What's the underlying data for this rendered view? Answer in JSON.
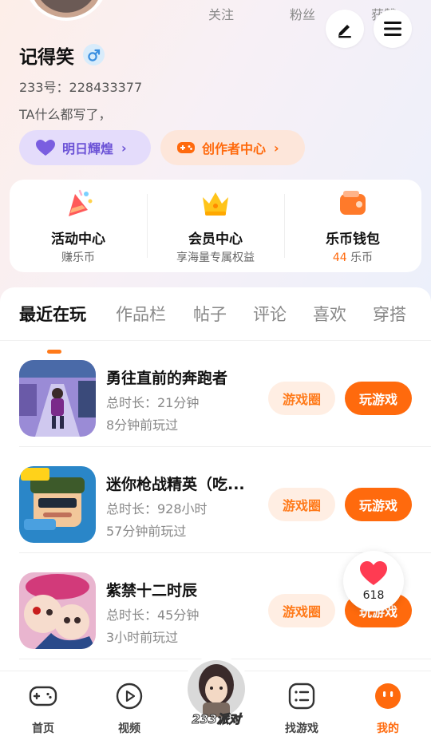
{
  "profile": {
    "stats": {
      "follow_label": "关注",
      "fans_label": "粉丝",
      "likes_label": "获赞"
    },
    "name": "记得笑",
    "uid": "233号：228433377",
    "bio": "TA什么都写了，",
    "pill_left": "明日輝煌",
    "pill_right": "创作者中心"
  },
  "quick": [
    {
      "title": "活动中心",
      "sub": "赚乐币"
    },
    {
      "title": "会员中心",
      "sub": "享海量专属权益"
    },
    {
      "title": "乐币钱包",
      "sub_value": "44",
      "sub_unit": "乐币"
    }
  ],
  "tabs": [
    "最近在玩",
    "作品栏",
    "帖子",
    "评论",
    "喜欢",
    "穿搭"
  ],
  "games": [
    {
      "title": "勇往直前的奔跑者",
      "duration": "总时长：21分钟",
      "last": "8分钟前玩过"
    },
    {
      "title": "迷你枪战精英（吃...",
      "duration": "总时长：928小时",
      "last": "57分钟前玩过"
    },
    {
      "title": "紫禁十二时辰",
      "duration": "总时长：45分钟",
      "last": "3小时前玩过"
    }
  ],
  "buttons": {
    "circle": "游戏圈",
    "play": "玩游戏"
  },
  "like_count": "618",
  "nav": [
    "首页",
    "视频",
    "找游戏",
    "我的"
  ],
  "center_badge": "233派对",
  "colors": {
    "accent": "#ff6a0d",
    "purple": "#6b52d6",
    "blue": "#3a8fe0"
  }
}
